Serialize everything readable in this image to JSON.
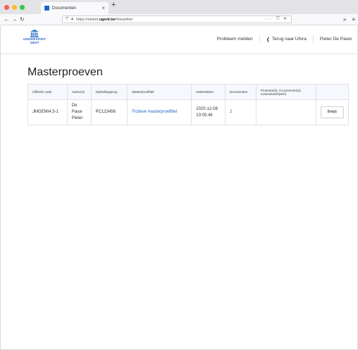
{
  "browser": {
    "tab_title": "Documenten",
    "url_prefix": "https://eloket.",
    "url_domain": "ugent.be",
    "url_path": "/thesis/list",
    "url_actions": "··· ⛉ ☆",
    "overflow": "»",
    "menu": "≡"
  },
  "header": {
    "logo_line1": "UNIVERSITEIT",
    "logo_line2": "GENT",
    "report_problem": "Probleem melden",
    "back_to_ufora": "Terug naar Ufora",
    "user_name": "Pieter De Pauw"
  },
  "page": {
    "title": "Masterproeven"
  },
  "table": {
    "headers": [
      "Officiële code",
      "Auteur(s)",
      "Opleidingsprog.",
      "Masterproeftitel",
      "Indiendatum",
      "Documenten",
      "Promotor(s), Co-promotor(s), Commissaris(sen)",
      ""
    ],
    "rows": [
      {
        "code": "JMGEMI4.5-1",
        "author_line1": "De",
        "author_line2": "Pauw",
        "author_line3": "Pieter",
        "program": "PC123456",
        "title": "Fictieve masterproeftitel",
        "date_line1": "2020-12-08",
        "date_line2": "13:05:46",
        "documents": "2",
        "promotors": "",
        "action": "Bekijk"
      }
    ]
  },
  "colors": {
    "accent": "#1e64c8",
    "header_bg": "#f5f8fc",
    "border": "#e1e1e1"
  }
}
